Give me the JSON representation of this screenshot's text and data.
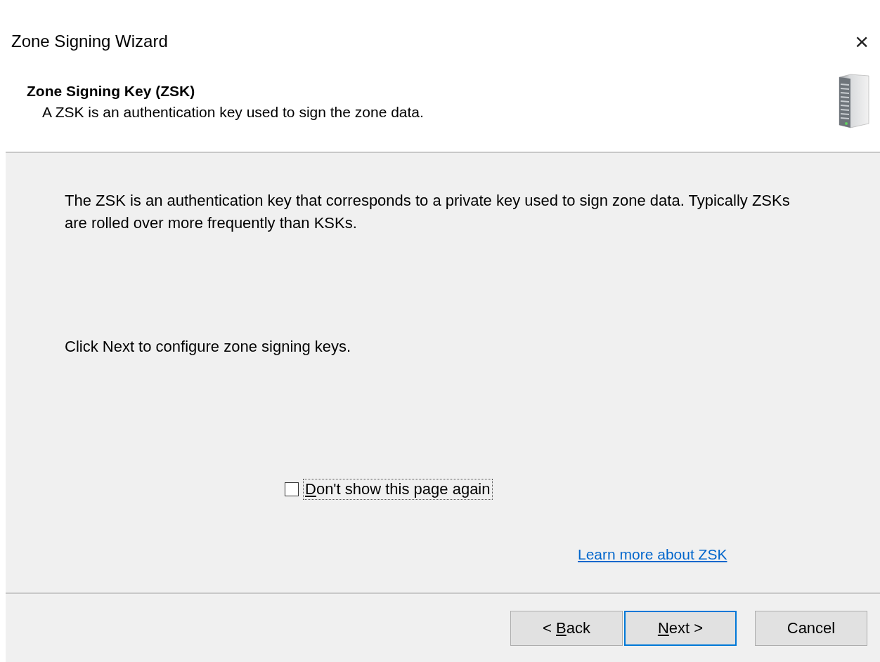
{
  "window": {
    "title": "Zone Signing Wizard",
    "close": "×"
  },
  "header": {
    "title": "Zone Signing Key (ZSK)",
    "subtitle": "A ZSK is an authentication key used to sign the zone data."
  },
  "body": {
    "paragraphs": [
      "The ZSK is an authentication key that corresponds to a private key used to sign zone data. Typically ZSKs are rolled over more frequently than KSKs.",
      "Click Next to configure zone signing keys."
    ],
    "checkbox": {
      "key": "D",
      "after": "on't show this page again",
      "checked": false,
      "focused": true
    },
    "link": "Learn more about ZSK"
  },
  "buttons": [
    {
      "before": "< ",
      "key": "B",
      "after": "ack",
      "default": false
    },
    {
      "key": "N",
      "after": "ext >",
      "default": true
    },
    {
      "before": "Cancel",
      "default": false
    }
  ]
}
